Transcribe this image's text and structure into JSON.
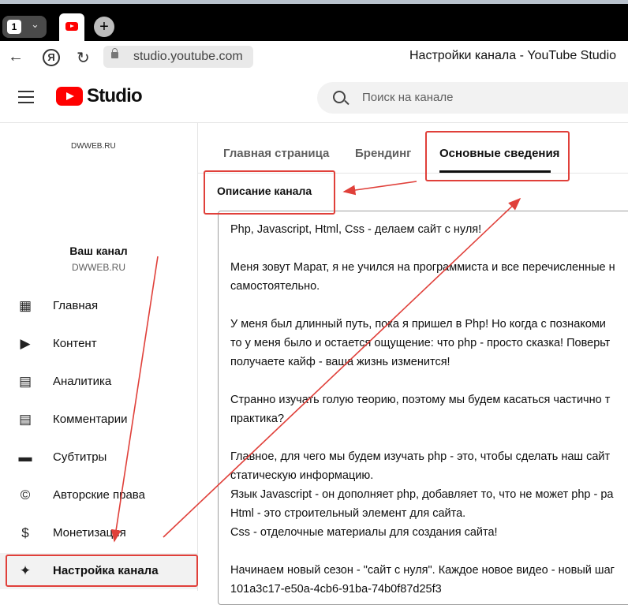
{
  "browser": {
    "tab_count": "1",
    "url": "studio.youtube.com",
    "page_title": "Настройки канала - YouTube Studio"
  },
  "header": {
    "logo_text": "Studio",
    "search_placeholder": "Поиск на канале"
  },
  "sidebar": {
    "avatar_text": "DWWEB.RU",
    "channel_label": "Ваш канал",
    "channel_handle": "DWWEB.RU",
    "items": [
      {
        "label": "Главная",
        "icon": "dashboard-icon"
      },
      {
        "label": "Контент",
        "icon": "content-icon"
      },
      {
        "label": "Аналитика",
        "icon": "analytics-icon"
      },
      {
        "label": "Комментарии",
        "icon": "comments-icon"
      },
      {
        "label": "Субтитры",
        "icon": "subtitles-icon"
      },
      {
        "label": "Авторские права",
        "icon": "copyright-icon"
      },
      {
        "label": "Монетизация",
        "icon": "monetization-icon"
      },
      {
        "label": "Настройка канала",
        "icon": "magic-wand-icon",
        "active": true
      }
    ]
  },
  "main": {
    "tabs": [
      "Главная страница",
      "Брендинг",
      "Основные сведения"
    ],
    "active_tab": "Основные сведения",
    "section_title": "Описание канала",
    "description_lines": [
      "Php, Javascript, Html, Css - делаем сайт с нуля!",
      "",
      "Меня зовут Марат, я не учился на программиста и все перечисленные н",
      "самостоятельно.",
      "",
      "У меня был длинный  путь, пока я пришел в Php! Но когда с познакоми",
      "то у меня было и остается ощущение: что php -  просто сказка! Поверьт",
      "получаете кайф - ваша жизнь изменится!",
      "",
      "Странно изучать голую теорию, поэтому мы будем касаться частично т",
      "практика?",
      "",
      "Главное, для чего мы будем изучать php  - это, чтобы сделать наш сайт",
      "статическую информацию.",
      "Язык Javascript - он дополняет  php, добавляет то, что не может php - ра",
      "Html - это строительный элемент для сайта.",
      "Css - отделочные материалы для создания сайта!",
      "",
      "Начинаем новый сезон - \"сайт с нуля\". Каждое новое видео - новый шаг",
      "101a3c17-e50a-4cb6-91ba-74b0f87d25f3"
    ]
  },
  "colors": {
    "accent_red": "#ff0000",
    "annotation_red": "#e0403a"
  }
}
